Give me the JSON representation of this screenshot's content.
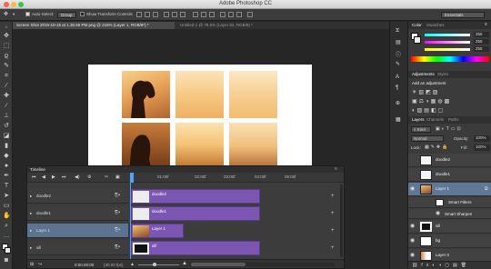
{
  "app": {
    "title": "Adobe Photoshop CC"
  },
  "options_bar": {
    "auto_select_label": "Auto-Select:",
    "auto_select_value": "Group",
    "show_transform_label": "Show Transform Controls",
    "workspace": "Essentials"
  },
  "tabs": [
    {
      "label": "Screen Shot 2016-10-15 at 1.30.56 PM.png @ 216% (Layer 1, RGB/8*) *",
      "active": true
    },
    {
      "label": "Untitled-1 @ 78.5% (Layer 82, RGB/8) *",
      "active": false
    }
  ],
  "timeline": {
    "title": "Timeline",
    "timecodes": [
      "01:00f",
      "02:00f",
      "03:00f",
      "04:00f",
      "05:00f"
    ],
    "tracks": [
      {
        "name": "doodle2",
        "clip": "doodle2",
        "selected": false
      },
      {
        "name": "doodle1",
        "clip": "doodle1",
        "selected": false
      },
      {
        "name": "Layer 1",
        "clip": "Layer 1",
        "selected": true
      },
      {
        "name": "sill",
        "clip": "sill",
        "selected": false
      }
    ],
    "time_display": "0:00:00:00",
    "fps": "(30.00 fps)"
  },
  "color_panel": {
    "tabs": [
      "Color",
      "Swatches"
    ],
    "values": [
      "255",
      "255",
      "255"
    ]
  },
  "adjustments_panel": {
    "tabs": [
      "Adjustments",
      "Styles"
    ],
    "hint": "Add an adjustment"
  },
  "layers_panel": {
    "tabs": [
      "Layers",
      "Channels",
      "Paths"
    ],
    "kind_label": "Kind",
    "blend_mode": "Normal",
    "opacity_label": "Opacity:",
    "opacity_value": "100%",
    "lock_label": "Lock:",
    "fill_label": "Fill:",
    "fill_value": "100%",
    "layers": [
      {
        "name": "doodle2",
        "selected": false,
        "indent": 0
      },
      {
        "name": "doodle1",
        "selected": false,
        "indent": 0
      },
      {
        "name": "Layer 1",
        "selected": true,
        "indent": 0
      },
      {
        "name": "Smart Filters",
        "selected": false,
        "indent": 1
      },
      {
        "name": "Smart Sharpen",
        "selected": false,
        "indent": 2
      },
      {
        "name": "sill",
        "selected": false,
        "indent": 0
      },
      {
        "name": "bg",
        "selected": false,
        "indent": 0
      },
      {
        "name": "Layer 0",
        "selected": false,
        "indent": 0
      }
    ]
  },
  "colors": {
    "clip": "#7b57b3",
    "selection": "#5f7896",
    "canvas": "#ffffff"
  }
}
